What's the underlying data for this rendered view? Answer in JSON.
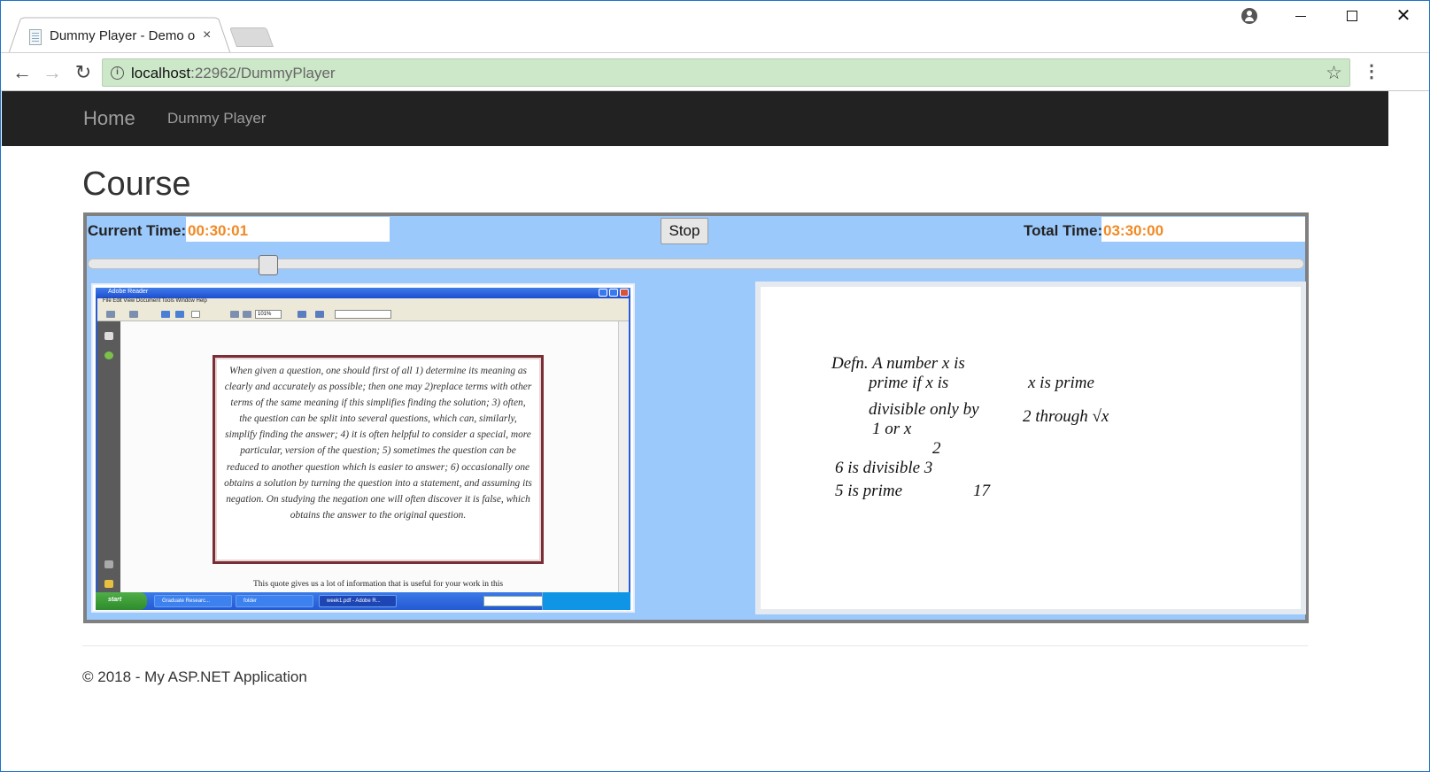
{
  "browser": {
    "tab_title": "Dummy Player - Demo o",
    "tab_close": "×",
    "url_host": "localhost",
    "url_rest": ":22962/DummyPlayer",
    "info_symbol": "i",
    "star_symbol": "☆",
    "menu_symbol": "⋮",
    "back_symbol": "←",
    "forward_symbol": "→",
    "reload_symbol": "↻",
    "close_symbol": "✕"
  },
  "navbar": {
    "brand": "Home",
    "links": [
      "Dummy Player"
    ]
  },
  "page": {
    "title": "Course"
  },
  "player": {
    "current_label": "Current Time:",
    "current_value": "00:30:01",
    "total_label": "Total Time:",
    "total_value": "03:30:00",
    "stop_label": "Stop",
    "progress_fraction": 0.143,
    "accent_color": "#f08a24",
    "panel_color": "#9cc9fb"
  },
  "pdf_viewer": {
    "window_title": "Adobe Reader",
    "menu": "File  Edit  View  Document  Tools  Window  Help",
    "zoom": "101%",
    "quote": "When given a question, one should first of all 1) determine its meaning as clearly and accurately as possible; then one may 2)replace terms with other terms of the same meaning if this simplifies finding the solution; 3) often, the question can be split into several questions, which can, similarly, simplify finding the answer; 4) it is often helpful to consider a special, more particular, version of the question; 5) sometimes the question can be reduced to another question which is easier to answer; 6) occasionally one obtains a solution by turning the question into a statement, and assuming its negation.  On studying the negation one will often discover it is false, which obtains the answer to the original question.",
    "body_text": "This quote gives us a lot of information that is useful for your work in this",
    "taskbar": {
      "start": "start",
      "items": [
        "Graduate Researc...",
        "folder",
        "week1.pdf - Adobe R..."
      ]
    }
  },
  "whiteboard": {
    "lines": [
      "Defn.  A number x is",
      "prime  if  x  is",
      "divisible  only  by",
      "1  or  x",
      "x is prime",
      "2  through  √x",
      "2",
      "6  is  divisible  3",
      "5  is  prime",
      "17"
    ]
  },
  "footer": {
    "text": "© 2018 - My ASP.NET Application"
  }
}
